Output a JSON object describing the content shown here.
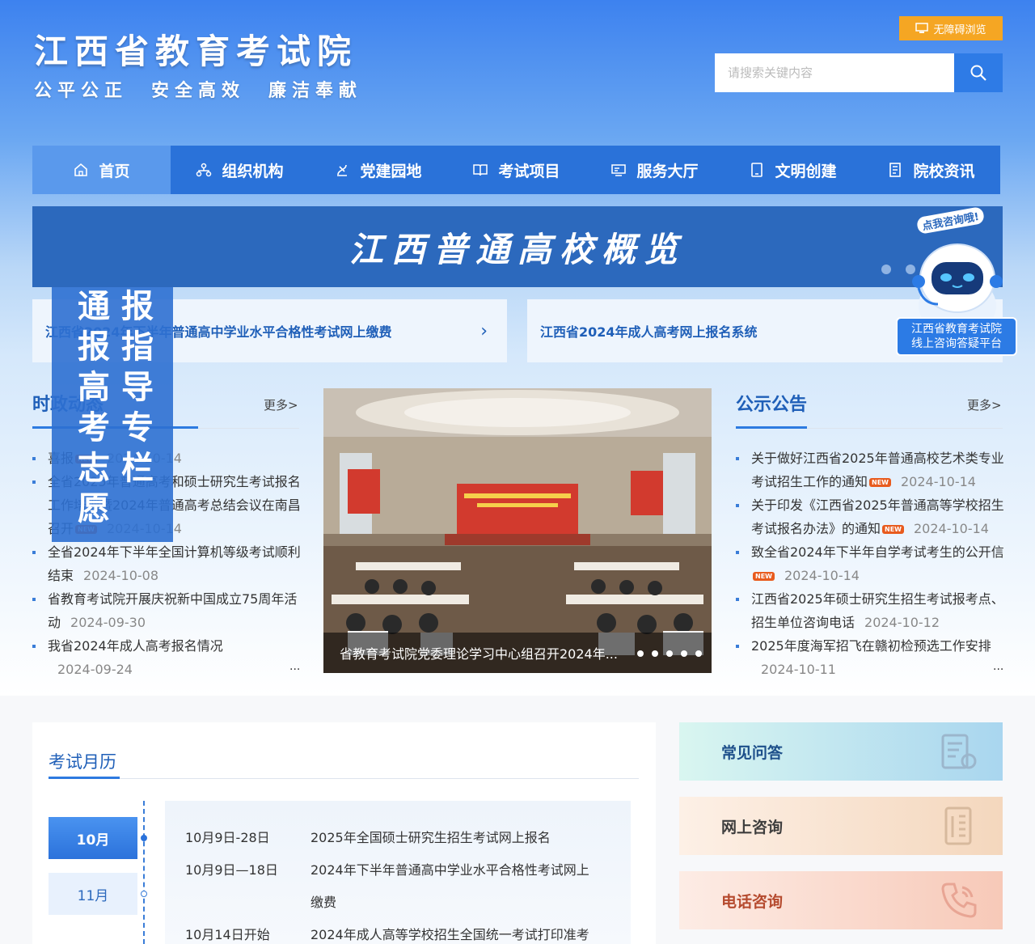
{
  "header": {
    "site_title": "江西省教育考试院",
    "slogan": "公平公正　安全高效　廉洁奉献",
    "accessibility_label": "无障碍浏览",
    "search_placeholder": "请搜索关键内容"
  },
  "nav": {
    "items": [
      {
        "label": "首页",
        "icon": "home-icon"
      },
      {
        "label": "组织机构",
        "icon": "org-icon"
      },
      {
        "label": "党建园地",
        "icon": "party-icon"
      },
      {
        "label": "考试项目",
        "icon": "book-icon"
      },
      {
        "label": "服务大厅",
        "icon": "service-icon"
      },
      {
        "label": "文明创建",
        "icon": "tablet-icon"
      },
      {
        "label": "院校资讯",
        "icon": "document-icon"
      }
    ]
  },
  "banner": {
    "title": "江西普通高校概览"
  },
  "quick_links": {
    "left": "江西省2024年下半年普通高中学业水平合格性考试网上缴费",
    "right": "江西省2024年成人高考网上报名系统"
  },
  "float_notice": {
    "col1": "通报高考志愿",
    "col2": "报指导专栏"
  },
  "robot": {
    "bubble": "点我咨询哦!",
    "label_line1": "江西省教育考试院",
    "label_line2": "线上咨询答疑平台"
  },
  "news": {
    "title": "时政动态",
    "more": "更多>",
    "items": [
      {
        "text": "喜报",
        "new": true,
        "date": "2024-10-14"
      },
      {
        "text": "全省2025年普通高考和硕士研究生考试报名工作培训暨2024年普通高考总结会议在南昌召开",
        "new": true,
        "date": "2024-10-14"
      },
      {
        "text": "全省2024年下半年全国计算机等级考试顺利结束",
        "new": false,
        "date": "2024-10-08"
      },
      {
        "text": "省教育考试院开展庆祝新中国成立75周年活动",
        "new": false,
        "date": "2024-09-30"
      },
      {
        "text": "我省2024年成人高考报名情况",
        "new": false,
        "date": "2024-09-24"
      }
    ],
    "new_label": "NEW",
    "ellipsis": "..."
  },
  "photo": {
    "caption": "省教育考试院党委理论学习中心组召开2024年..."
  },
  "notices": {
    "title": "公示公告",
    "more": "更多>",
    "items": [
      {
        "text": "关于做好江西省2025年普通高校艺术类专业考试招生工作的通知",
        "new": true,
        "date": "2024-10-14"
      },
      {
        "text": "关于印发《江西省2025年普通高等学校招生考试报名办法》的通知",
        "new": true,
        "date": "2024-10-14"
      },
      {
        "text": "致全省2024年下半年自学考试考生的公开信",
        "new": true,
        "date": "2024-10-14"
      },
      {
        "text": "江西省2025年硕士研究生招生考试报考点、招生单位咨询电话",
        "new": false,
        "date": "2024-10-12"
      },
      {
        "text": "2025年度海军招飞在赣初检预选工作安排",
        "new": false,
        "date": "2024-10-11"
      }
    ],
    "ellipsis": "..."
  },
  "calendar": {
    "title": "考试月历",
    "months": [
      "10月",
      "11月"
    ],
    "events": [
      {
        "date": "10月9日-28日",
        "title": "2025年全国硕士研究生招生考试网上报名"
      },
      {
        "date": "10月9日—18日",
        "title": "2024年下半年普通高中学业水平合格性考试网上缴费"
      },
      {
        "date": "10月14日开始",
        "title": "2024年成人高等学校招生全国统一考试打印准考"
      }
    ]
  },
  "side_cards": [
    {
      "label": "常见问答",
      "icon": "faq-icon"
    },
    {
      "label": "网上咨询",
      "icon": "online-doc-icon"
    },
    {
      "label": "电话咨询",
      "icon": "phone-icon"
    }
  ],
  "colors": {
    "primary": "#2a72d9",
    "accent_orange": "#f5a623",
    "new_tag": "#e85b1e"
  }
}
